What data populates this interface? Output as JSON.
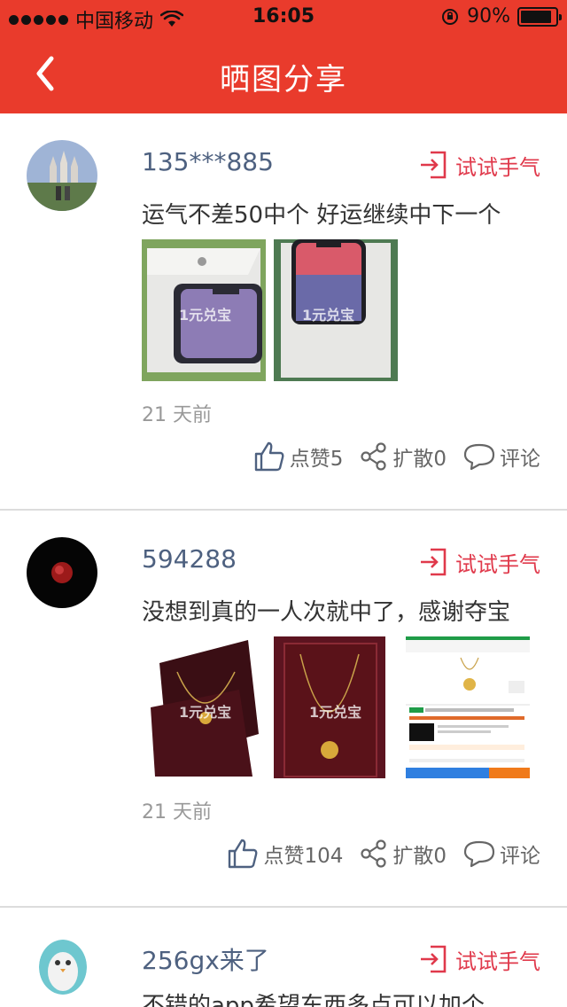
{
  "status_bar": {
    "carrier": "中国移动",
    "time": "16:05",
    "battery": "90%",
    "battery_level": 0.9
  },
  "nav": {
    "title": "晒图分享"
  },
  "posts": [
    {
      "username": "135***885",
      "try_label": "试试手气",
      "content": "运气不差50中个 好运继续中下一个",
      "photo_watermark": "1元兑宝",
      "time": "21 天前",
      "like": "点赞5",
      "share": "扩散0",
      "comment": "评论"
    },
    {
      "username": "594288",
      "try_label": "试试手气",
      "content": "没想到真的一人次就中了，感谢夺宝",
      "photo_watermark": "1元兑宝",
      "time": "21 天前",
      "like": "点赞104",
      "share": "扩散0",
      "comment": "评论"
    },
    {
      "username": "256gx来了",
      "try_label": "试试手气",
      "content": "不错的app希望东西多点可以加个"
    }
  ],
  "colors": {
    "brand_red": "#e93b2c",
    "username": "#4e6180",
    "try_red": "#e0394b"
  }
}
